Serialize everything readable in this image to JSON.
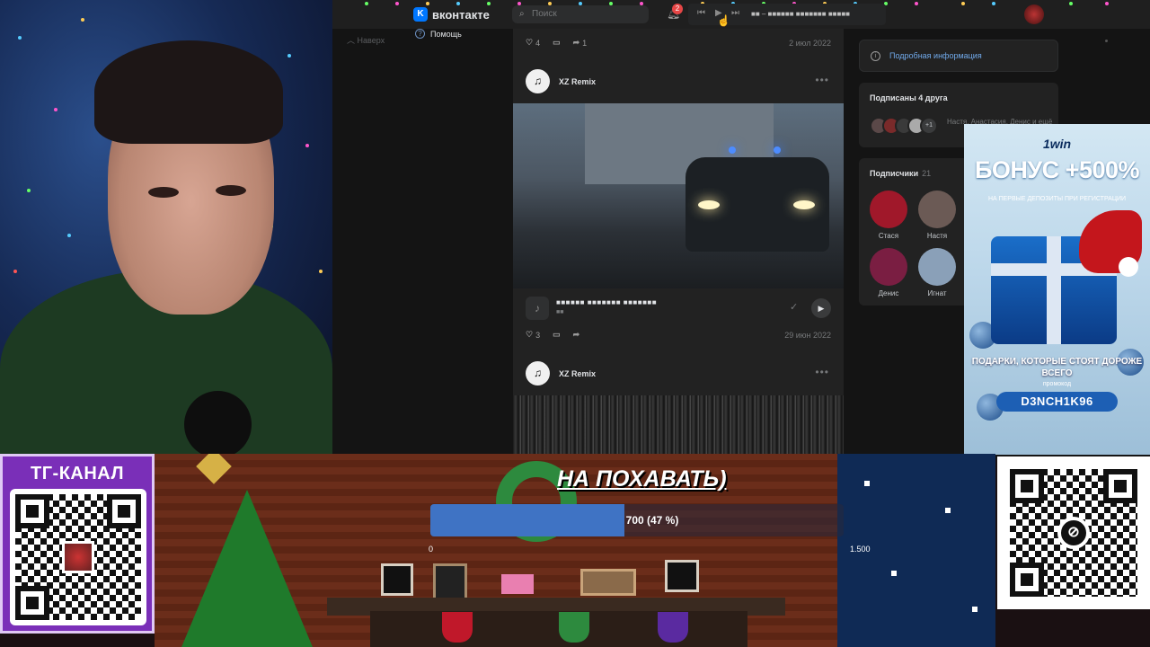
{
  "vk": {
    "logo_text": "вконтакте",
    "logo_mark": "K",
    "search_placeholder": "Поиск",
    "notif_count": "2",
    "player_track": "■■ – ■■■■■■ ■■■■■■■ ■■■■■",
    "nav_up": "Наверх",
    "help": "Помощь"
  },
  "feed": {
    "post0": {
      "likes": "4",
      "shares": "1",
      "date": "2 июл 2022"
    },
    "post1": {
      "author": "XZ Remix",
      "audio_title": "■■■■■■ ■■■■■■■ ■■■■■■■",
      "audio_sub": "■■",
      "likes": "3",
      "date": "29 июн 2022"
    },
    "post2": {
      "author": "XZ Remix"
    }
  },
  "sidebar": {
    "info_button": "Подробная информация",
    "friends_title": "Подписаны 4 друга",
    "friends_more": "+1",
    "friends_names": "Настя, Анастасия, Денис и ещё",
    "subscribers_title": "Подписчики",
    "subscribers_count": "21",
    "subscribers": [
      {
        "name": "Стася",
        "color": "#a0182a"
      },
      {
        "name": "Настя",
        "color": "#6b5a55"
      },
      {
        "name": "Денис",
        "color": "#7a1e42"
      },
      {
        "name": "Игнат",
        "color": "#8aa0b8"
      }
    ]
  },
  "ad": {
    "brand": "1win",
    "headline": "БОНУС +500%",
    "subline": "НА ПЕРВЫЕ ДЕПОЗИТЫ ПРИ РЕГИСТРАЦИИ",
    "gifts_text": "ПОДАРКИ, КОТОРЫЕ СТОЯТ ДОРОЖЕ ВСЕГО",
    "promo_label": "промокод",
    "promo_code": "D3NCH1K96"
  },
  "stream": {
    "tg_label": "ТГ-КАНАЛ",
    "goal_title": "НА ПОХАВАТЬ)",
    "goal_progress_text": "700 (47 %)",
    "goal_progress": 0.47,
    "goal_min": "0",
    "goal_max": "1.500"
  },
  "colors": {
    "vk_blue": "#0077ff",
    "goal_fill": "#3f73c4",
    "tg_purple": "#7a2fb8"
  }
}
